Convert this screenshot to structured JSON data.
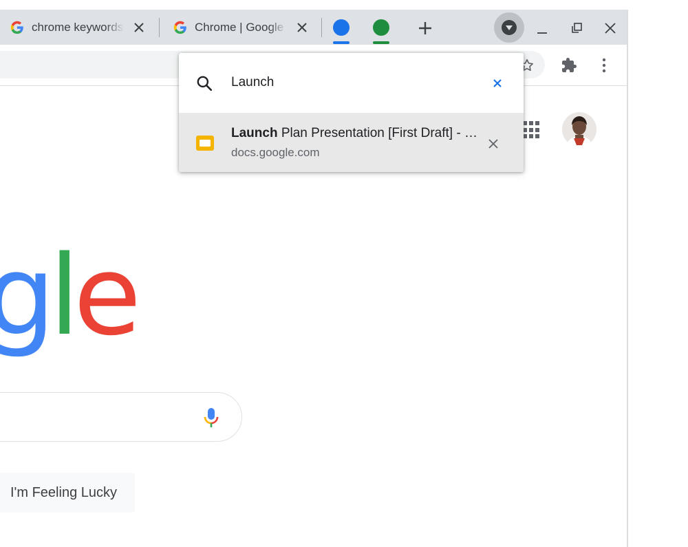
{
  "tabs": [
    {
      "title": "chrome keywords",
      "close_icon": "close-icon"
    },
    {
      "title": "Chrome | Google",
      "close_icon": "close-icon"
    }
  ],
  "tab_groups": [
    {
      "color": "#1a73e8"
    },
    {
      "color": "#1e8e3e"
    }
  ],
  "tab_search": {
    "query": "Launch",
    "result": {
      "title_match": "Launch",
      "title_rest": " Plan Presentation [First Draft] - Google Slides",
      "url": "docs.google.com"
    }
  },
  "google": {
    "logo_visible": "ogle",
    "lucky_button": "I'm Feeling Lucky"
  },
  "colors": {
    "tabstrip": "#dee1e6",
    "google_blue": "#4285f4",
    "google_red": "#ea4335",
    "google_yellow": "#fbbc05",
    "google_green": "#34a853"
  }
}
